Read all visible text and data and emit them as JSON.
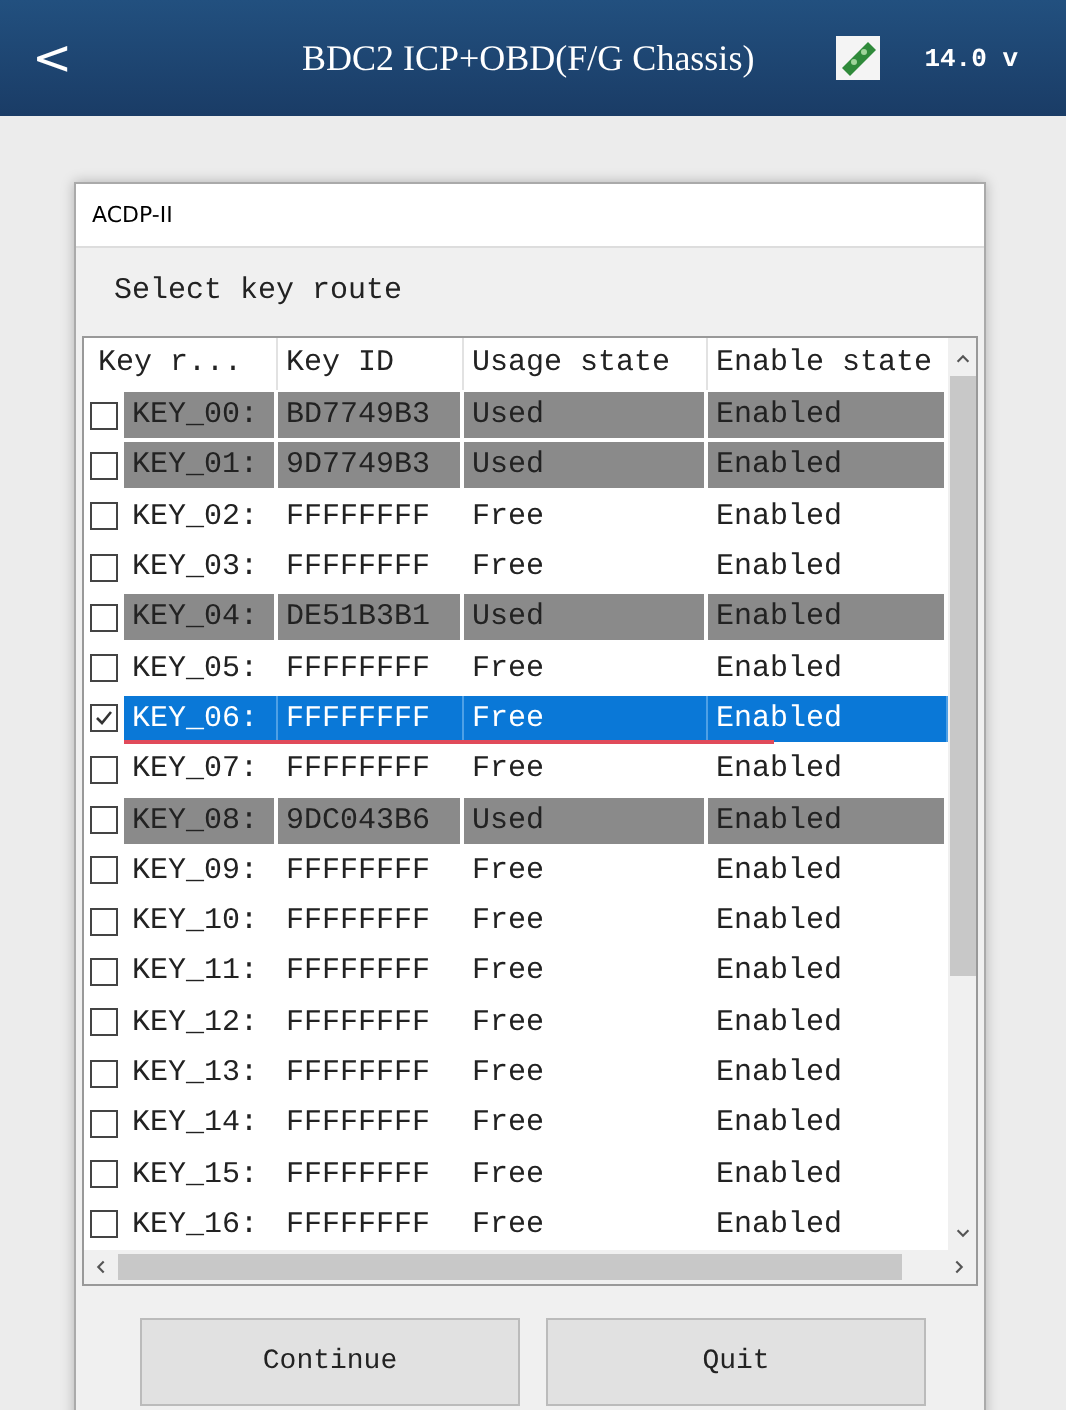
{
  "header": {
    "back": "<",
    "title": "BDC2 ICP+OBD(F/G Chassis)",
    "voltage": "14.0 v"
  },
  "dialog": {
    "title": "ACDP-II",
    "prompt": "Select key route",
    "columns": [
      "Key r...",
      "Key ID",
      "Usage state",
      "Enable state"
    ],
    "rows": [
      {
        "route": "KEY_00:",
        "key_id": "BD7749B3",
        "usage": "Used",
        "enable": "Enabled",
        "checked": false,
        "selected": false,
        "highlighted": true
      },
      {
        "route": "KEY_01:",
        "key_id": "9D7749B3",
        "usage": "Used",
        "enable": "Enabled",
        "checked": false,
        "selected": false,
        "highlighted": true
      },
      {
        "route": "KEY_02:",
        "key_id": "FFFFFFFF",
        "usage": "Free",
        "enable": "Enabled",
        "checked": false,
        "selected": false,
        "highlighted": false
      },
      {
        "route": "KEY_03:",
        "key_id": "FFFFFFFF",
        "usage": "Free",
        "enable": "Enabled",
        "checked": false,
        "selected": false,
        "highlighted": false
      },
      {
        "route": "KEY_04:",
        "key_id": "DE51B3B1",
        "usage": "Used",
        "enable": "Enabled",
        "checked": false,
        "selected": false,
        "highlighted": true
      },
      {
        "route": "KEY_05:",
        "key_id": "FFFFFFFF",
        "usage": "Free",
        "enable": "Enabled",
        "checked": false,
        "selected": false,
        "highlighted": false
      },
      {
        "route": "KEY_06:",
        "key_id": "FFFFFFFF",
        "usage": "Free",
        "enable": "Enabled",
        "checked": true,
        "selected": true,
        "highlighted": false
      },
      {
        "route": "KEY_07:",
        "key_id": "FFFFFFFF",
        "usage": "Free",
        "enable": "Enabled",
        "checked": false,
        "selected": false,
        "highlighted": false
      },
      {
        "route": "KEY_08:",
        "key_id": "9DC043B6",
        "usage": "Used",
        "enable": "Enabled",
        "checked": false,
        "selected": false,
        "highlighted": true
      },
      {
        "route": "KEY_09:",
        "key_id": "FFFFFFFF",
        "usage": "Free",
        "enable": "Enabled",
        "checked": false,
        "selected": false,
        "highlighted": false
      },
      {
        "route": "KEY_10:",
        "key_id": "FFFFFFFF",
        "usage": "Free",
        "enable": "Enabled",
        "checked": false,
        "selected": false,
        "highlighted": false
      },
      {
        "route": "KEY_11:",
        "key_id": "FFFFFFFF",
        "usage": "Free",
        "enable": "Enabled",
        "checked": false,
        "selected": false,
        "highlighted": false
      },
      {
        "route": "KEY_12:",
        "key_id": "FFFFFFFF",
        "usage": "Free",
        "enable": "Enabled",
        "checked": false,
        "selected": false,
        "highlighted": false
      },
      {
        "route": "KEY_13:",
        "key_id": "FFFFFFFF",
        "usage": "Free",
        "enable": "Enabled",
        "checked": false,
        "selected": false,
        "highlighted": false
      },
      {
        "route": "KEY_14:",
        "key_id": "FFFFFFFF",
        "usage": "Free",
        "enable": "Enabled",
        "checked": false,
        "selected": false,
        "highlighted": false
      },
      {
        "route": "KEY_15:",
        "key_id": "FFFFFFFF",
        "usage": "Free",
        "enable": "Enabled",
        "checked": false,
        "selected": false,
        "highlighted": false
      },
      {
        "route": "KEY_16:",
        "key_id": "FFFFFFFF",
        "usage": "Free",
        "enable": "Enabled",
        "checked": false,
        "selected": false,
        "highlighted": false
      }
    ],
    "buttons": [
      "Continue",
      "Quit"
    ]
  }
}
